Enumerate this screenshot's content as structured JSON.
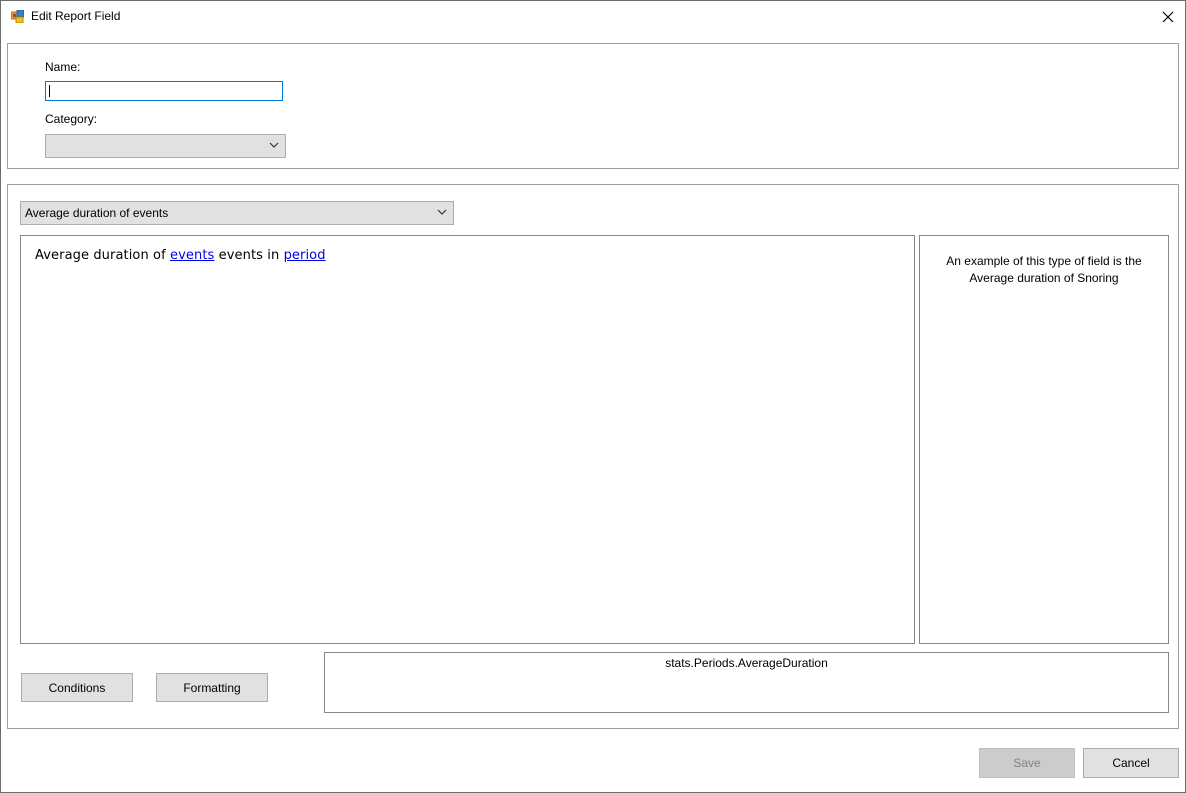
{
  "window": {
    "title": "Edit Report Field",
    "close_icon": "close-icon"
  },
  "form": {
    "name_label": "Name:",
    "name_value": "",
    "category_label": "Category:",
    "category_value": ""
  },
  "field": {
    "type_selected": "Average duration of events",
    "sentence": {
      "part1": "Average duration of ",
      "link_events": "events",
      "part2": " events in ",
      "link_period": "period"
    },
    "example_line1": "An example of this type of field is the",
    "example_line2": "Average duration of Snoring",
    "expression": "stats.Periods.AverageDuration"
  },
  "buttons": {
    "conditions": "Conditions",
    "formatting": "Formatting",
    "save": "Save",
    "cancel": "Cancel"
  },
  "colors": {
    "link": "#0000ee",
    "focus_border": "#0078d7",
    "button_face": "#e1e1e1"
  }
}
